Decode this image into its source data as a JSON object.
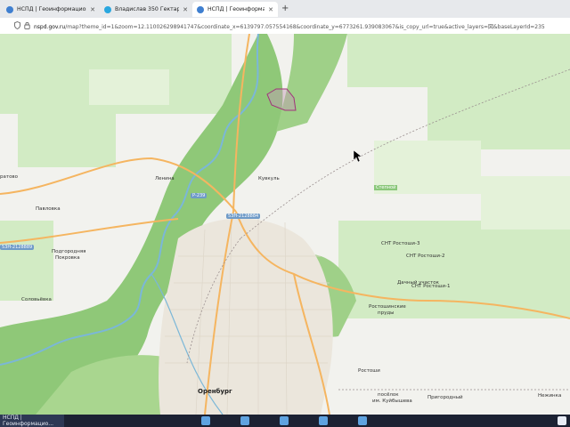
{
  "browser": {
    "tabs": [
      {
        "label": "НСПД | Геоинформацион",
        "icon": "nspd-icon",
        "active": false
      },
      {
        "label": "Владислав 350 Гектар",
        "icon": "telegram-icon",
        "active": false
      },
      {
        "label": "НСПД | Геоинформацион",
        "icon": "nspd-icon",
        "active": true
      }
    ],
    "new_tab_symbol": "+",
    "close_symbol": "✕",
    "url_host": "nspd.gov.ru",
    "url_path": "/map?theme_id=1&zoom=12.110026298941747&coordinate_x=6139797.057554168&coordinate_y=6773261.939083067&is_copy_url=true&active_layers=図&baseLayerId=235"
  },
  "map": {
    "labels": {
      "city": "Оренбург",
      "lenina": "Ленина",
      "kuvkul": "Кувкуль",
      "pavlovka": "Павловка",
      "podgorodnyaya1": "Подгородняя",
      "podgorodnyaya2": "Покровка",
      "soloviyovka": "Соловьёвка",
      "rostoshi": "Ростоши",
      "rostoshinskie1": "Ростошинские",
      "rostoshinskie2": "пруды",
      "kuybysheva1": "посёлок",
      "kuybysheva2": "им. Куйбышева",
      "prigorodny": "Пригородный",
      "nezhinka": "Нежинка",
      "stepnoy": "Степной",
      "snt1": "СНТ Ростоши-3",
      "snt2": "СНТ Ростоши-2",
      "snt3": "СНТ Ростоши-1",
      "dachny": "Дачный участок",
      "left_edge": "ратово",
      "road_r239": "Р-239",
      "road_53on1": "53Н-2128884",
      "road_53on2": "53Н-2128889"
    },
    "colors": {
      "background": "#f2f2ee",
      "forest": "#8fc878",
      "field": "#c9e6b9",
      "river": "#7bb7d8",
      "highway": "#f5b560",
      "urban": "#ebe6dc",
      "parcel_outline": "#a0337a"
    }
  },
  "taskbar": {
    "active_item": "НСПД | Геоинформацио..."
  }
}
